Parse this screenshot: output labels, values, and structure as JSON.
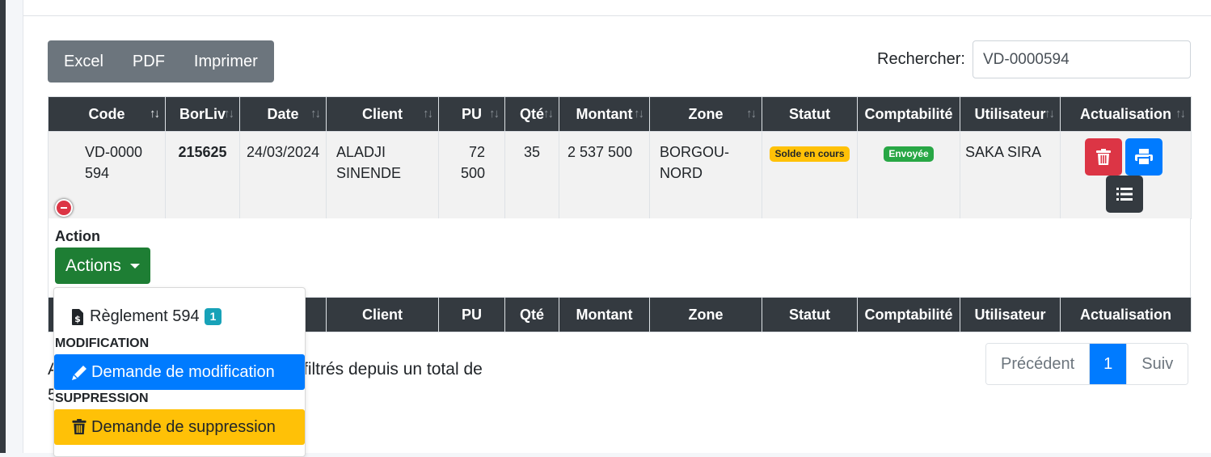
{
  "toolbar": {
    "excel": "Excel",
    "pdf": "PDF",
    "print": "Imprimer"
  },
  "search": {
    "label": "Rechercher:",
    "value": "VD-0000594"
  },
  "table": {
    "headers": [
      "Code",
      "BorLiv",
      "Date",
      "Client",
      "PU",
      "Qté",
      "Montant",
      "Zone",
      "Statut",
      "Comptabilité",
      "Utilisateur",
      "Actualisation"
    ],
    "row": {
      "code": "VD-0000594",
      "borliv": "215625",
      "date": "24/03/2024",
      "client": "ALADJI SINENDE",
      "pu": "72 500",
      "qte": "35",
      "montant": "2 537 500",
      "zone": "BORGOU-NORD",
      "statut": "Solde en cours",
      "comptabilite": "Envoyée",
      "utilisateur": "SAKA SIRA"
    }
  },
  "child": {
    "action_label": "Action",
    "actions_button": "Actions"
  },
  "dropdown": {
    "reglement_label": "Règlement 594",
    "reglement_count": "1",
    "section_modification": "MODIFICATION",
    "modification_button": "Demande de modification",
    "section_suppression": "SUPPRESSION",
    "suppression_button": "Demande de suppression"
  },
  "info": {
    "line1_start": "A",
    "line1_end": "filtrés depuis un total de",
    "line2_start": "5"
  },
  "pagination": {
    "prev": "Précédent",
    "current": "1",
    "next": "Suiv"
  },
  "colors": {
    "primary": "#007bff",
    "success": "#1e7e34",
    "danger": "#dc3545",
    "warning": "#ffc107",
    "info": "#17a2b8",
    "dark": "#343a40",
    "secondary": "#6c757d"
  }
}
